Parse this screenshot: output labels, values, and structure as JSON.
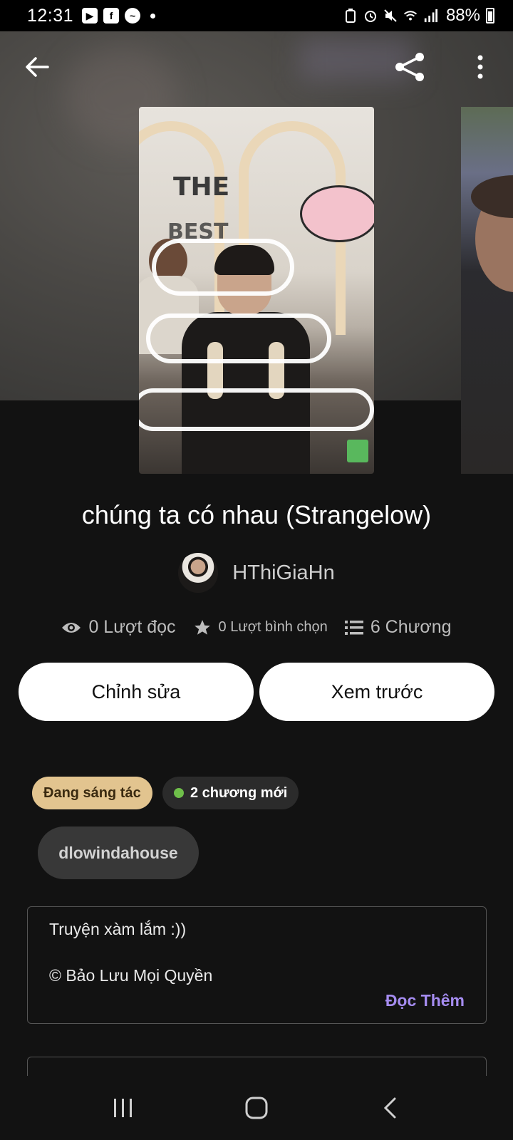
{
  "status_bar": {
    "time": "12:31",
    "battery": "88%",
    "left_icons": [
      "tv-icon",
      "facebook-icon",
      "messenger-icon"
    ],
    "right_icons": [
      "battery-saver-icon",
      "alarm-icon",
      "mute-icon",
      "wifi-icon",
      "signal-icon"
    ]
  },
  "story": {
    "title": "chúng ta có nhau (Strangelow)",
    "author": "HThiGiaHn",
    "cover_text_1": "THE",
    "cover_text_2": "BEST"
  },
  "stats": {
    "reads": "0 Lượt đọc",
    "votes": "0 Lượt bình chọn",
    "chapters": "6 Chương"
  },
  "actions": {
    "edit_label": "Chỉnh sửa",
    "preview_label": "Xem trước"
  },
  "tags": {
    "status": "Đang sáng tác",
    "new_chapters": "2 chương mới",
    "tag_chip": "dlowindahouse"
  },
  "description": {
    "line1": "Truyện xàm lắm :))",
    "line2": "© Bảo Lưu Mọi Quyền",
    "read_more": "Đọc Thêm"
  },
  "colors": {
    "background": "#121212",
    "status_tag": "#e2c48f",
    "accent_link": "#a58cf0",
    "new_dot": "#6fbf4a"
  }
}
